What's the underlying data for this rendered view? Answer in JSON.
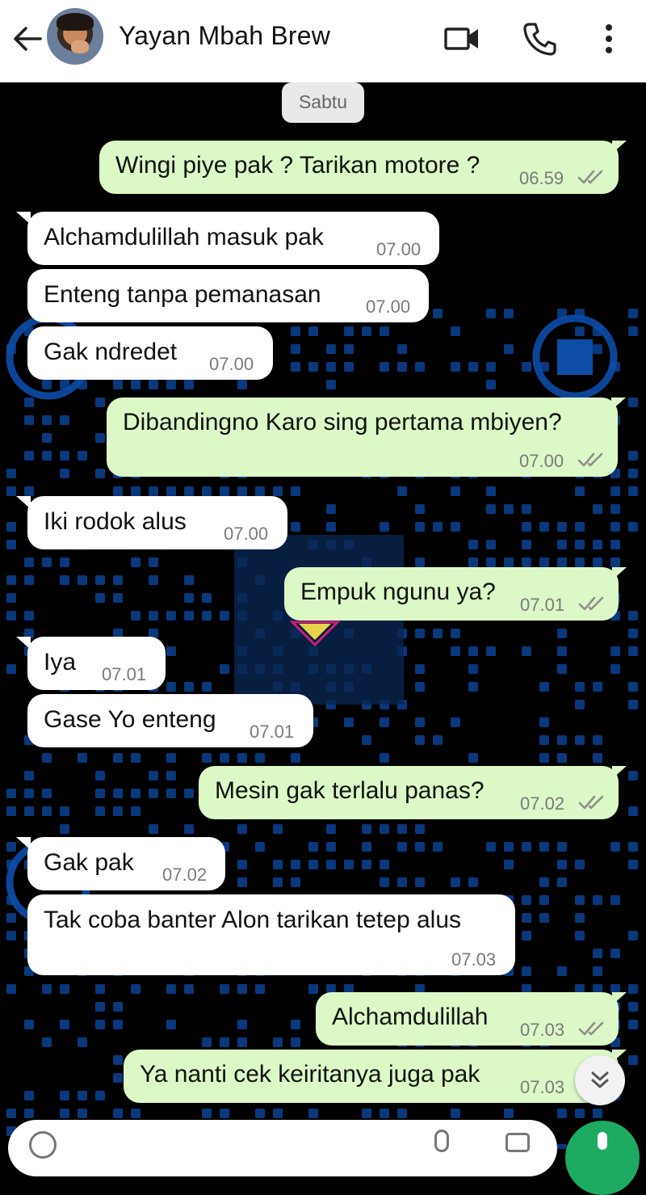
{
  "header": {
    "contact_name": "Yayan Mbah Brew",
    "icons": [
      "back-arrow-icon",
      "video-call-icon",
      "phone-call-icon",
      "more-options-icon"
    ]
  },
  "date_chip": "Sabtu",
  "messages": [
    {
      "dir": "out",
      "text": "Wingi piye pak ? Tarikan motore ?",
      "time": "06.59",
      "read": true
    },
    {
      "dir": "in",
      "text": "Alchamdulillah masuk pak",
      "time": "07.00"
    },
    {
      "dir": "in",
      "text": "Enteng tanpa pemanasan",
      "time": "07.00"
    },
    {
      "dir": "in",
      "text": "Gak ndredet",
      "time": "07.00"
    },
    {
      "dir": "out",
      "text": "Dibandingno Karo sing pertama mbiyen?",
      "time": "07.00",
      "read": true
    },
    {
      "dir": "in",
      "text": "Iki rodok alus",
      "time": "07.00"
    },
    {
      "dir": "out",
      "text": "Empuk ngunu ya?",
      "time": "07.01",
      "read": true
    },
    {
      "dir": "in",
      "text": "Iya",
      "time": "07.01"
    },
    {
      "dir": "in",
      "text": "Gase Yo enteng",
      "time": "07.01"
    },
    {
      "dir": "out",
      "text": "Mesin gak terlalu panas?",
      "time": "07.02",
      "read": true
    },
    {
      "dir": "in",
      "text": "Gak pak",
      "time": "07.02"
    },
    {
      "dir": "in",
      "text": "Tak coba banter Alon tarikan tetep alus",
      "time": "07.03"
    },
    {
      "dir": "out",
      "text": "Alchamdulillah",
      "time": "07.03",
      "read": true
    },
    {
      "dir": "out",
      "text": "Ya nanti cek keiritanya juga pak",
      "time": "07.03",
      "read": true
    }
  ],
  "colors": {
    "outgoing_bubble": "#dcf8c6",
    "incoming_bubble": "#ffffff",
    "read_ticks": "#8e8e8e",
    "wallpaper": "#000000",
    "wallpaper_pattern": "#0b3f8a",
    "mic_button": "#1daa61"
  }
}
